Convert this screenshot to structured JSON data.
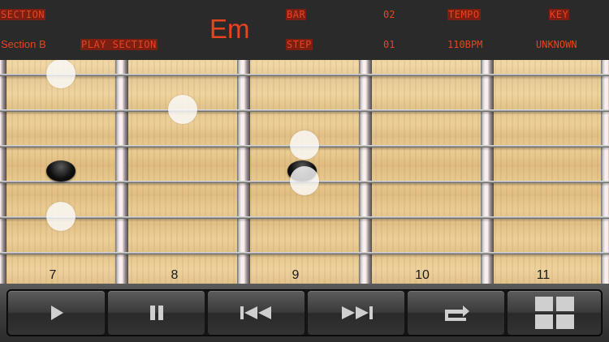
{
  "header": {
    "section_label": "SECTION",
    "section_value": "Section B",
    "play_section_label": "PLAY SECTION",
    "chord": "Em",
    "bar_label": "BAR",
    "bar_value": "02",
    "step_label": "STEP",
    "step_value": "01",
    "tempo_label": "TEMPO",
    "tempo_value": "110BPM",
    "key_label": "KEY",
    "key_value": "UNKNOWN"
  },
  "fretboard": {
    "fret_numbers": [
      "7",
      "8",
      "9",
      "10",
      "11"
    ]
  },
  "toolbar": {
    "buttons": [
      "play-icon",
      "pause-icon",
      "previous-icon",
      "next-icon",
      "repeat-icon",
      "grid-menu-icon"
    ]
  },
  "colors": {
    "accent": "#e8441f",
    "label_background": "#7a1f12",
    "header_background": "#2a2a2a"
  }
}
